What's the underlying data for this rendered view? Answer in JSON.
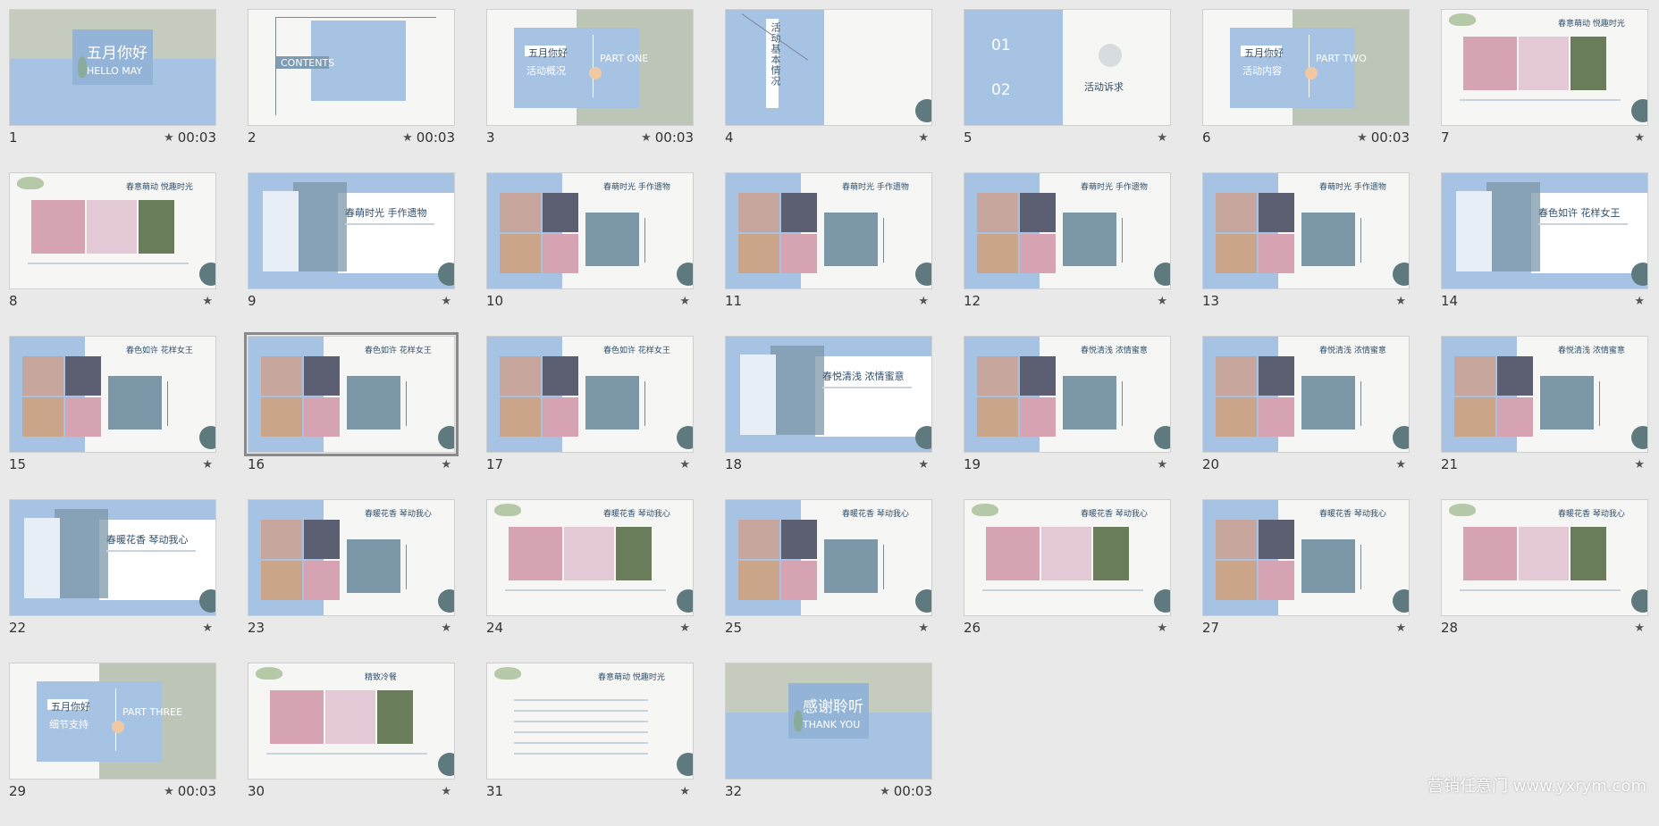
{
  "slides": [
    {
      "num": "1",
      "time": "00:03",
      "layout": "cover",
      "title": "五月你好",
      "sub": "HELLO MAY"
    },
    {
      "num": "2",
      "time": "00:03",
      "layout": "contents",
      "title": "CONTENTS"
    },
    {
      "num": "3",
      "time": "00:03",
      "layout": "part",
      "tag": "五月你好",
      "title": "活动概况",
      "part": "PART ONE"
    },
    {
      "num": "4",
      "time": "",
      "layout": "info",
      "vtitle": "活动基本情况"
    },
    {
      "num": "5",
      "time": "",
      "layout": "numbers",
      "caption": "活动诉求"
    },
    {
      "num": "6",
      "time": "00:03",
      "layout": "part",
      "tag": "五月你好",
      "title": "活动内容",
      "part": "PART TWO"
    },
    {
      "num": "7",
      "time": "",
      "layout": "photos",
      "title": "春意萌动 悦趣时光"
    },
    {
      "num": "8",
      "time": "",
      "layout": "photos",
      "title": "春意萌动 悦趣时光"
    },
    {
      "num": "9",
      "time": "",
      "layout": "section",
      "title": "春萌时光 手作遗物"
    },
    {
      "num": "10",
      "time": "",
      "layout": "photo-text",
      "title": "春萌时光 手作遗物"
    },
    {
      "num": "11",
      "time": "",
      "layout": "photo-text",
      "title": "春萌时光 手作遗物"
    },
    {
      "num": "12",
      "time": "",
      "layout": "photo-text",
      "title": "春萌时光 手作遗物"
    },
    {
      "num": "13",
      "time": "",
      "layout": "photo-text",
      "title": "春萌时光 手作遗物"
    },
    {
      "num": "14",
      "time": "",
      "layout": "section",
      "title": "春色如许 花样女王"
    },
    {
      "num": "15",
      "time": "",
      "layout": "photo-text",
      "title": "春色如许 花样女王"
    },
    {
      "num": "16",
      "time": "",
      "layout": "photo-text",
      "title": "春色如许 花样女王",
      "selected": true
    },
    {
      "num": "17",
      "time": "",
      "layout": "photo-text",
      "title": "春色如许 花样女王"
    },
    {
      "num": "18",
      "time": "",
      "layout": "section",
      "title": "春悦清浅 浓情蜜意"
    },
    {
      "num": "19",
      "time": "",
      "layout": "photo-text",
      "title": "春悦清浅 浓情蜜意"
    },
    {
      "num": "20",
      "time": "",
      "layout": "photo-text",
      "title": "春悦清浅 浓情蜜意"
    },
    {
      "num": "21",
      "time": "",
      "layout": "photo-text",
      "title": "春悦清浅 浓情蜜意"
    },
    {
      "num": "22",
      "time": "",
      "layout": "section",
      "title": "春暖花香 琴动我心"
    },
    {
      "num": "23",
      "time": "",
      "layout": "photo-text",
      "title": "春暖花香 琴动我心"
    },
    {
      "num": "24",
      "time": "",
      "layout": "photos",
      "title": "春暖花香 琴动我心"
    },
    {
      "num": "25",
      "time": "",
      "layout": "photo-text",
      "title": "春暖花香 琴动我心"
    },
    {
      "num": "26",
      "time": "",
      "layout": "photos",
      "title": "春暖花香 琴动我心"
    },
    {
      "num": "27",
      "time": "",
      "layout": "photo-text",
      "title": "春暖花香 琴动我心"
    },
    {
      "num": "28",
      "time": "",
      "layout": "photos",
      "title": "春暖花香 琴动我心"
    },
    {
      "num": "29",
      "time": "00:03",
      "layout": "part",
      "tag": "五月你好",
      "title": "细节支持",
      "part": "PART THREE"
    },
    {
      "num": "30",
      "time": "",
      "layout": "photos",
      "title": "精致冷餐"
    },
    {
      "num": "31",
      "time": "",
      "layout": "text",
      "title": "春意萌动 悦趣时光"
    },
    {
      "num": "32",
      "time": "00:03",
      "layout": "cover",
      "title": "感谢聆听",
      "sub": "THANK YOU"
    }
  ],
  "star": "★",
  "watermark": "营销任意门 www.yxrym.com"
}
